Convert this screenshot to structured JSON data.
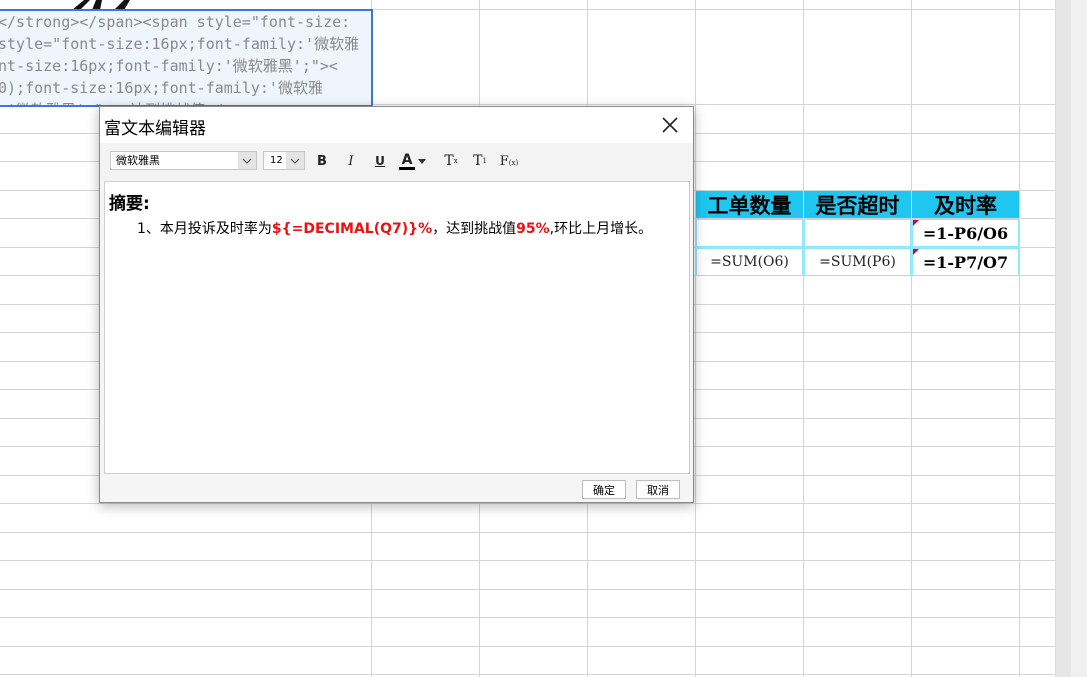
{
  "code_lines": [
    "  </strong></span><span style=\"font-size:",
    "style=\"font-size:16px;font-family:'微软雅",
    "nt-size:16px;font-family:'微软雅黑';\"><",
    "0);font-size:16px;font-family:'微软雅",
    ":'微软雅黑';\">, 达到挑战值</"
  ],
  "table": {
    "headers": [
      "工单数量",
      "是否超时",
      "及时率"
    ],
    "row1": [
      "",
      "",
      "=1-P6/O6"
    ],
    "row2": [
      "=SUM(O6)",
      "=SUM(P6)",
      "=1-P7/O7"
    ]
  },
  "dialog": {
    "title": "富文本编辑器",
    "font_value": "微软雅黑",
    "size_value": "12",
    "toolbar": {
      "bold": "B",
      "italic": "I",
      "underline": "U",
      "font_color": "A",
      "superscript": "T",
      "superscript_mark": "x",
      "subscript": "T",
      "subscript_mark": "1",
      "formula": "F",
      "formula_mark": "(x)"
    },
    "content": {
      "heading": "摘要:",
      "p1": "1、本月投诉及时率为",
      "p2": "${=DECIMAL(Q7)}%",
      "p3": "，达到挑战值",
      "p4": "95%",
      "p5": ",环比上月增长。"
    },
    "ok_label": "确定",
    "cancel_label": "取消"
  },
  "colors": {
    "header_bg": "#1ec6f0",
    "cell_border": "#8fe6ff",
    "highlight_red": "#ee1111",
    "selection_border": "#3a78d8"
  }
}
